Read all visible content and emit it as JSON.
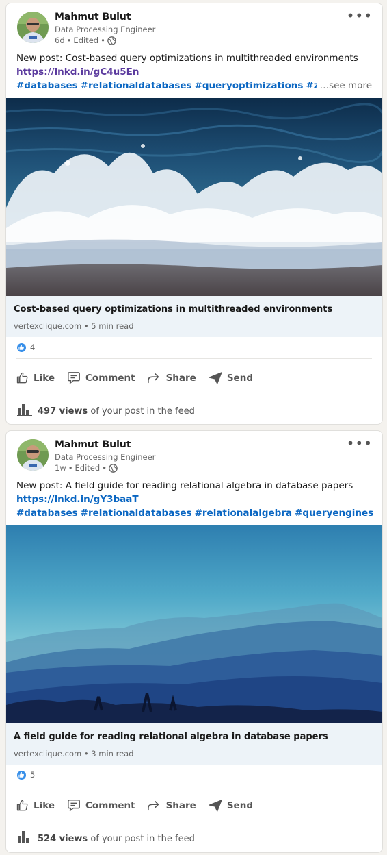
{
  "posts": [
    {
      "author": "Mahmut Bulut",
      "headline": "Data Processing Engineer",
      "time": "6d",
      "edited": "Edited",
      "sep": "•",
      "more_icon": "•••",
      "text": "New post: Cost-based query optimizations in multithreaded environments",
      "link": "https://lnkd.in/gC4u5En",
      "link_color": "#5b3a9e",
      "hashtags": [
        "#databases",
        "#relationaldatabases",
        "#queryoptimizations",
        "#zonemap"
      ],
      "see_more": "…see more",
      "image": "ocean-waves-photo",
      "card_title": "Cost-based query optimizations in multithreaded environments",
      "card_source": "vertexclique.com • 5 min read",
      "reactions": "4",
      "actions": {
        "like": "Like",
        "comment": "Comment",
        "share": "Share",
        "send": "Send"
      },
      "views_count": "497 views",
      "views_suffix": "of your post in the feed"
    },
    {
      "author": "Mahmut Bulut",
      "headline": "Data Processing Engineer",
      "time": "1w",
      "edited": "Edited",
      "sep": "•",
      "more_icon": "•••",
      "text": "New post: A field guide for reading relational algebra in database papers",
      "link": "https://lnkd.in/gY3baaT",
      "link_color": "#0a66c2",
      "hashtags": [
        "#databases",
        "#relationaldatabases",
        "#relationalalgebra",
        "#queryengines"
      ],
      "image": "misty-mountains-photo",
      "card_title": "A field guide for reading relational algebra in database papers",
      "card_source": "vertexclique.com • 3 min read",
      "reactions": "5",
      "actions": {
        "like": "Like",
        "comment": "Comment",
        "share": "Share",
        "send": "Send"
      },
      "views_count": "524 views",
      "views_suffix": "of your post in the feed"
    }
  ]
}
